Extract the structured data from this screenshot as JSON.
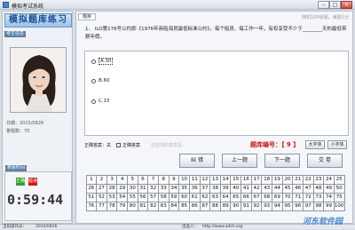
{
  "window": {
    "title": "模拟考试系统",
    "min": "–",
    "max": "□",
    "close": "×"
  },
  "sidebar": {
    "logo_text": "模拟题库练习",
    "candidate_section": "考生信息",
    "photo_icon": "user-photo",
    "exam_date": "日期：2015/0826",
    "answered": "答题数：70",
    "timer_section": "剩余时间",
    "status_green": "正确",
    "status_red": "错误",
    "timer": "0:59:44"
  },
  "main": {
    "tab": "题目",
    "candidate_info": "随机100道题，每题1分",
    "question": "1． ILO第176号公约即《1976年商船海员最低标准公约》，每个船员、每工作一年，有权享受不少于________天的最低带薪年假。",
    "options": [
      {
        "label": "A.30",
        "selected": true
      },
      {
        "label": "B.60",
        "selected": false
      },
      {
        "label": "C.15",
        "selected": false
      }
    ],
    "answer_label": "正确答案：",
    "answer_value": "关",
    "show_answer_label": "正确答案",
    "hint_text": "您选择的答案是：",
    "question_number_label": "题库编号：【 9 】",
    "font_up": "大字体",
    "font_down": "小字体",
    "buttons": {
      "mark": "纠 错",
      "prev": "上一题",
      "next": "下一题",
      "submit": "交 卷"
    },
    "question_grid": [
      "1",
      "2",
      "3",
      "4",
      "5",
      "6",
      "7",
      "8",
      "9",
      "10",
      "11",
      "12",
      "13",
      "14",
      "15",
      "16",
      "17",
      "18",
      "19",
      "20",
      "21",
      "22",
      "23",
      "24",
      "25",
      "26",
      "27",
      "28",
      "29",
      "30",
      "31",
      "32",
      "33",
      "34",
      "35",
      "36",
      "37",
      "38",
      "39",
      "40",
      "41",
      "42",
      "43",
      "44",
      "45",
      "46",
      "47",
      "48",
      "49",
      "50",
      "51",
      "52",
      "53",
      "54",
      "55",
      "56",
      "57",
      "58",
      "59",
      "60",
      "61",
      "62",
      "63",
      "64",
      "65",
      "66",
      "67",
      "68",
      "69",
      "70",
      "71",
      "72",
      "73",
      "74",
      "75",
      "76",
      "77",
      "78",
      "79",
      "80",
      "81",
      "82",
      "83",
      "84",
      "85",
      "86",
      "87",
      "88",
      "89",
      "90",
      "91",
      "92",
      "93",
      "94",
      "95",
      "96",
      "97",
      "98",
      "99",
      "100"
    ]
  },
  "statusbar": {
    "left": "当前操作员：",
    "date": "2015/0826",
    "center": "出品人：",
    "url": "http://www.xdsh.org",
    "watermark": "河东软件园"
  },
  "colors": {
    "accent": "#1a4f8f",
    "red": "#d01818",
    "green": "#2aa02a"
  }
}
